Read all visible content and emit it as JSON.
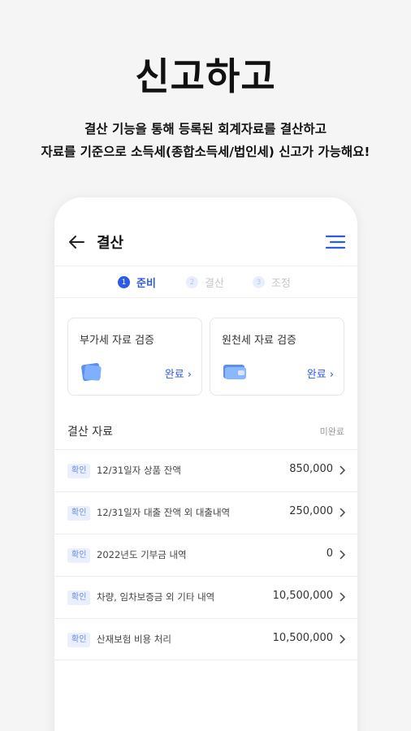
{
  "hero": {
    "title": "신고하고",
    "desc_line1": "결산 기능을 통해 등록된 회계자료를 결산하고",
    "desc_line2": "자료를 기준으로 소득세(종합소득세/법인세) 신고가 가능해요!"
  },
  "topbar": {
    "title": "결산",
    "back_icon": "arrow-left-icon",
    "menu_icon": "menu-icon"
  },
  "steps": [
    {
      "num": "1",
      "label": "준비",
      "active": true
    },
    {
      "num": "2",
      "label": "결산",
      "active": false
    },
    {
      "num": "3",
      "label": "조정",
      "active": false
    }
  ],
  "cards": [
    {
      "title": "부가세 자료 검증",
      "status": "완료"
    },
    {
      "title": "원천세 자료 검증",
      "status": "완료"
    }
  ],
  "section": {
    "title": "결산 자료",
    "status": "미완료"
  },
  "rows": [
    {
      "badge": "확인",
      "label": "12/31일자 상품 잔액",
      "value": "850,000"
    },
    {
      "badge": "확인",
      "label": "12/31일자 대출 잔액 외 대출내역",
      "value": "250,000"
    },
    {
      "badge": "확인",
      "label": "2022년도 기부금 내역",
      "value": "0"
    },
    {
      "badge": "확인",
      "label": "차량, 임차보증금 외 기타 내역",
      "value": "10,500,000"
    },
    {
      "badge": "확인",
      "label": "산재보험 비용 처리",
      "value": "10,500,000"
    }
  ],
  "colors": {
    "accent": "#2d5be3",
    "background": "#f5f5f5",
    "badge_bg": "#e9effd"
  }
}
